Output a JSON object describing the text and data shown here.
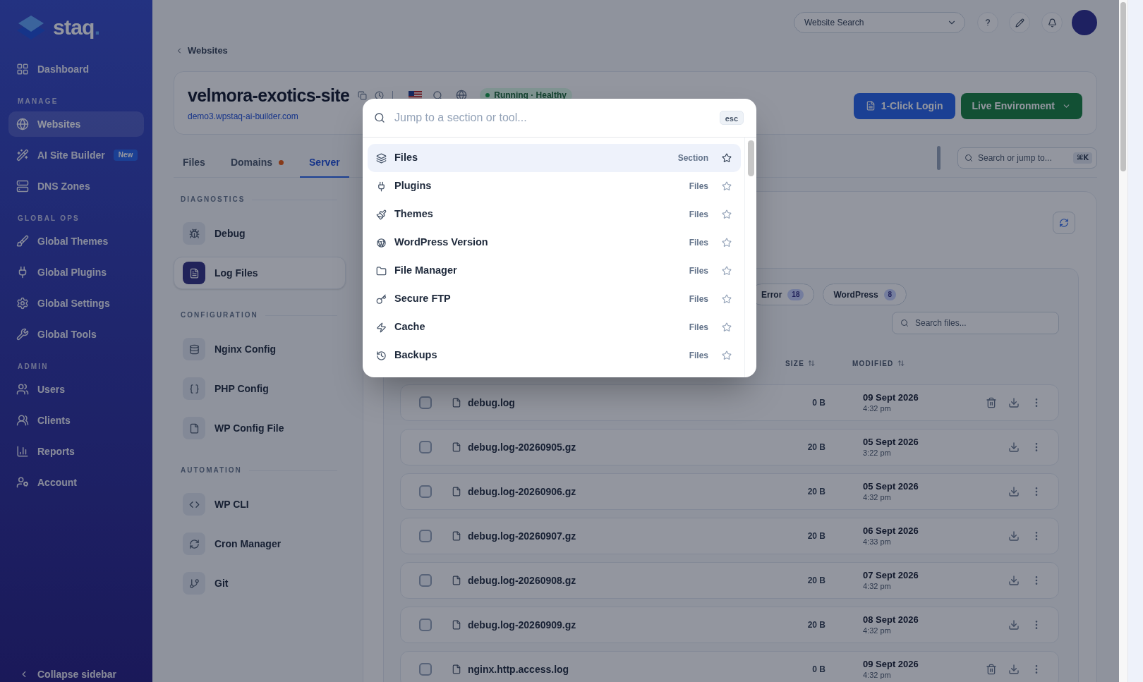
{
  "sidebar": {
    "brand": "staq",
    "brand_mark": ".",
    "groups": [
      {
        "items": [
          {
            "label": "Dashboard",
            "selected": false
          }
        ]
      },
      {
        "heading": "MANAGE",
        "items": [
          {
            "label": "Websites",
            "selected": true
          },
          {
            "label": "AI Site Builder",
            "selected": false,
            "badge": "New"
          },
          {
            "label": "DNS Zones",
            "selected": false
          }
        ]
      },
      {
        "heading": "GLOBAL OPS",
        "items": [
          {
            "label": "Global Themes",
            "selected": false
          },
          {
            "label": "Global Plugins",
            "selected": false
          },
          {
            "label": "Global Settings",
            "selected": false
          },
          {
            "label": "Global Tools",
            "selected": false
          }
        ]
      },
      {
        "heading": "ADMIN",
        "items": [
          {
            "label": "Users",
            "selected": false
          },
          {
            "label": "Clients",
            "selected": false
          },
          {
            "label": "Reports",
            "selected": false
          },
          {
            "label": "Account",
            "selected": false
          }
        ]
      }
    ],
    "collapse": "Collapse sidebar"
  },
  "header": {
    "website_search": {
      "placeholder": "Website Search"
    }
  },
  "breadcrumb": "Websites",
  "site": {
    "title": "velmora-exotics-site",
    "url": "demo3.wpstaq-ai-builder.com",
    "status": {
      "label": "Running · Healthy",
      "kind": "healthy"
    },
    "actions": [
      {
        "label": "1-Click Login",
        "kind": "primary"
      },
      {
        "label": "Live Environment",
        "kind": "environment"
      }
    ]
  },
  "tabs": [
    {
      "label": "Files",
      "selected": false,
      "dot": false
    },
    {
      "label": "Domains",
      "selected": false,
      "dot": true
    },
    {
      "label": "Server",
      "selected": true,
      "dot": false
    }
  ],
  "quick_search": {
    "placeholder": "Search or jump to...",
    "shortcut": "⌘K"
  },
  "server_nav": [
    {
      "heading": "DIAGNOSTICS",
      "items": [
        {
          "label": "Debug",
          "selected": false
        },
        {
          "label": "Log Files",
          "selected": true
        }
      ]
    },
    {
      "heading": "CONFIGURATION",
      "items": [
        {
          "label": "Nginx Config",
          "selected": false
        },
        {
          "label": "PHP Config",
          "selected": false
        },
        {
          "label": "WP Config File",
          "selected": false
        }
      ]
    },
    {
      "heading": "AUTOMATION",
      "items": [
        {
          "label": "WP CLI",
          "selected": false
        },
        {
          "label": "Cron Manager",
          "selected": false
        },
        {
          "label": "Git",
          "selected": false
        }
      ]
    }
  ],
  "log_files": {
    "filters": [
      {
        "label": "Error",
        "count": "18"
      },
      {
        "label": "WordPress",
        "count": "8"
      }
    ],
    "search": {
      "placeholder": "Search files..."
    },
    "columns": [
      "SIZE",
      "MODIFIED"
    ],
    "rows": [
      {
        "name": "debug.log",
        "size": "0 B",
        "date": "09 Sept 2026",
        "time": "4:32 pm",
        "checked": false,
        "deletable": true
      },
      {
        "name": "debug.log-20260905.gz",
        "size": "20 B",
        "date": "05 Sept 2026",
        "time": "3:22 pm",
        "checked": false,
        "deletable": false
      },
      {
        "name": "debug.log-20260906.gz",
        "size": "20 B",
        "date": "05 Sept 2026",
        "time": "4:32 pm",
        "checked": false,
        "deletable": false
      },
      {
        "name": "debug.log-20260907.gz",
        "size": "20 B",
        "date": "06 Sept 2026",
        "time": "4:33 pm",
        "checked": false,
        "deletable": false
      },
      {
        "name": "debug.log-20260908.gz",
        "size": "20 B",
        "date": "07 Sept 2026",
        "time": "4:32 pm",
        "checked": false,
        "deletable": false
      },
      {
        "name": "debug.log-20260909.gz",
        "size": "20 B",
        "date": "08 Sept 2026",
        "time": "4:32 pm",
        "checked": false,
        "deletable": false
      },
      {
        "name": "nginx.http.access.log",
        "size": "0 B",
        "date": "09 Sept 2026",
        "time": "4:32 pm",
        "checked": false,
        "deletable": true
      }
    ]
  },
  "command_palette": {
    "placeholder": "Jump to a section or tool...",
    "dismiss": "esc",
    "items": [
      {
        "label": "Files",
        "group": "Section",
        "selected": true,
        "starred": false
      },
      {
        "label": "Plugins",
        "group": "Files",
        "selected": false,
        "starred": false
      },
      {
        "label": "Themes",
        "group": "Files",
        "selected": false,
        "starred": false
      },
      {
        "label": "WordPress Version",
        "group": "Files",
        "selected": false,
        "starred": false
      },
      {
        "label": "File Manager",
        "group": "Files",
        "selected": false,
        "starred": false
      },
      {
        "label": "Secure FTP",
        "group": "Files",
        "selected": false,
        "starred": false
      },
      {
        "label": "Cache",
        "group": "Files",
        "selected": false,
        "starred": false
      },
      {
        "label": "Backups",
        "group": "Files",
        "selected": false,
        "starred": false
      }
    ]
  }
}
